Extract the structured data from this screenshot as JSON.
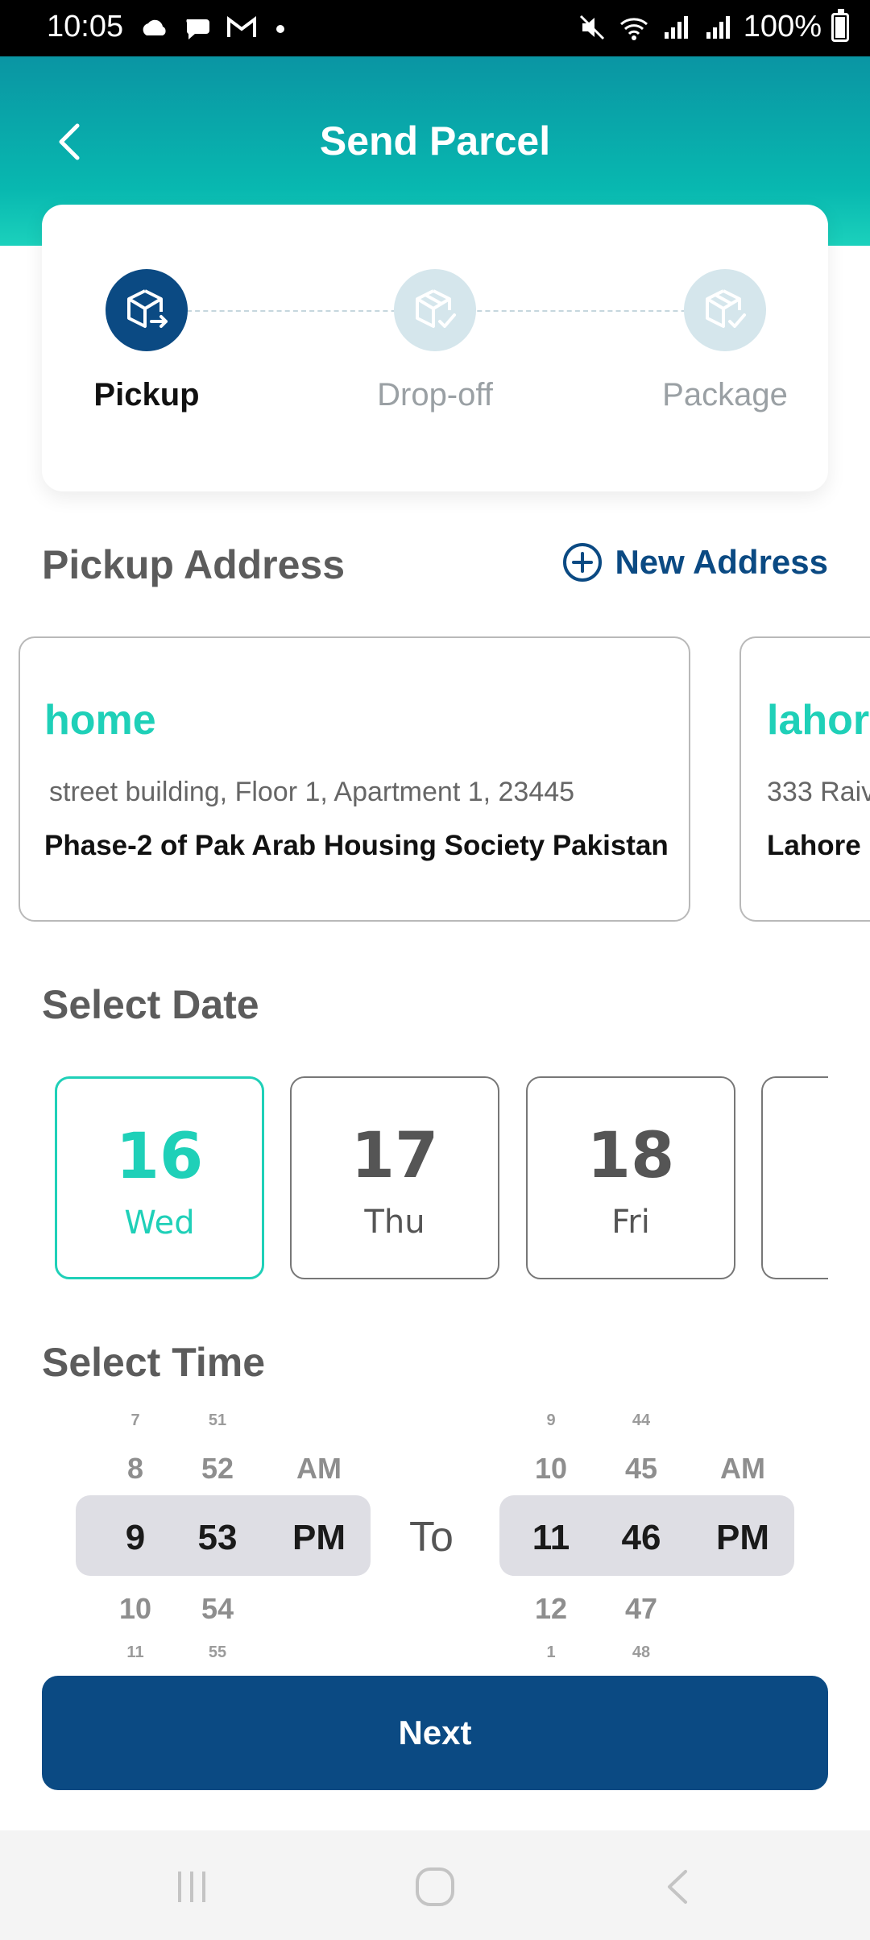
{
  "status_bar": {
    "time": "10:05",
    "battery": "100%",
    "icons": [
      "cloud-icon",
      "chat-icon",
      "gmail-icon",
      "dot-icon",
      "mute-icon",
      "wifi-icon",
      "signal-icon",
      "signal-icon-2",
      "battery-icon"
    ]
  },
  "header": {
    "title": "Send Parcel",
    "back_icon": "chevron-left-icon"
  },
  "stepper": {
    "steps": [
      {
        "label": "Pickup",
        "state": "active"
      },
      {
        "label": "Drop-off",
        "state": "inactive"
      },
      {
        "label": "Package",
        "state": "inactive"
      }
    ]
  },
  "pickup": {
    "title": "Pickup Address",
    "new_address_label": "New Address",
    "addresses": [
      {
        "name": "home",
        "line1": "street building, Floor 1, Apartment 1, 23445",
        "line2": "Phase-2 of Pak Arab Housing Society Pakistan"
      },
      {
        "name": "lahore",
        "line1": "333 Raiv",
        "line2": "Lahore P"
      }
    ]
  },
  "date": {
    "title": "Select Date",
    "options": [
      {
        "num": "16",
        "day": "Wed",
        "selected": true
      },
      {
        "num": "17",
        "day": "Thu",
        "selected": false
      },
      {
        "num": "18",
        "day": "Fri",
        "selected": false
      },
      {
        "num": "",
        "day": "",
        "selected": false
      }
    ]
  },
  "time": {
    "title": "Select Time",
    "to_label": "To",
    "from": {
      "hour": [
        "7",
        "8",
        "9",
        "10",
        "11"
      ],
      "minute": [
        "51",
        "52",
        "53",
        "54",
        "55"
      ],
      "period": [
        "AM",
        "PM"
      ]
    },
    "to": {
      "hour": [
        "9",
        "10",
        "11",
        "12",
        "1"
      ],
      "minute": [
        "44",
        "45",
        "46",
        "47",
        "48"
      ],
      "period": [
        "AM",
        "PM"
      ]
    }
  },
  "next_label": "Next",
  "colors": {
    "primary": "#0b4a83",
    "accent": "#1fd0b8",
    "header_gradient_top": "#0a95a3"
  }
}
